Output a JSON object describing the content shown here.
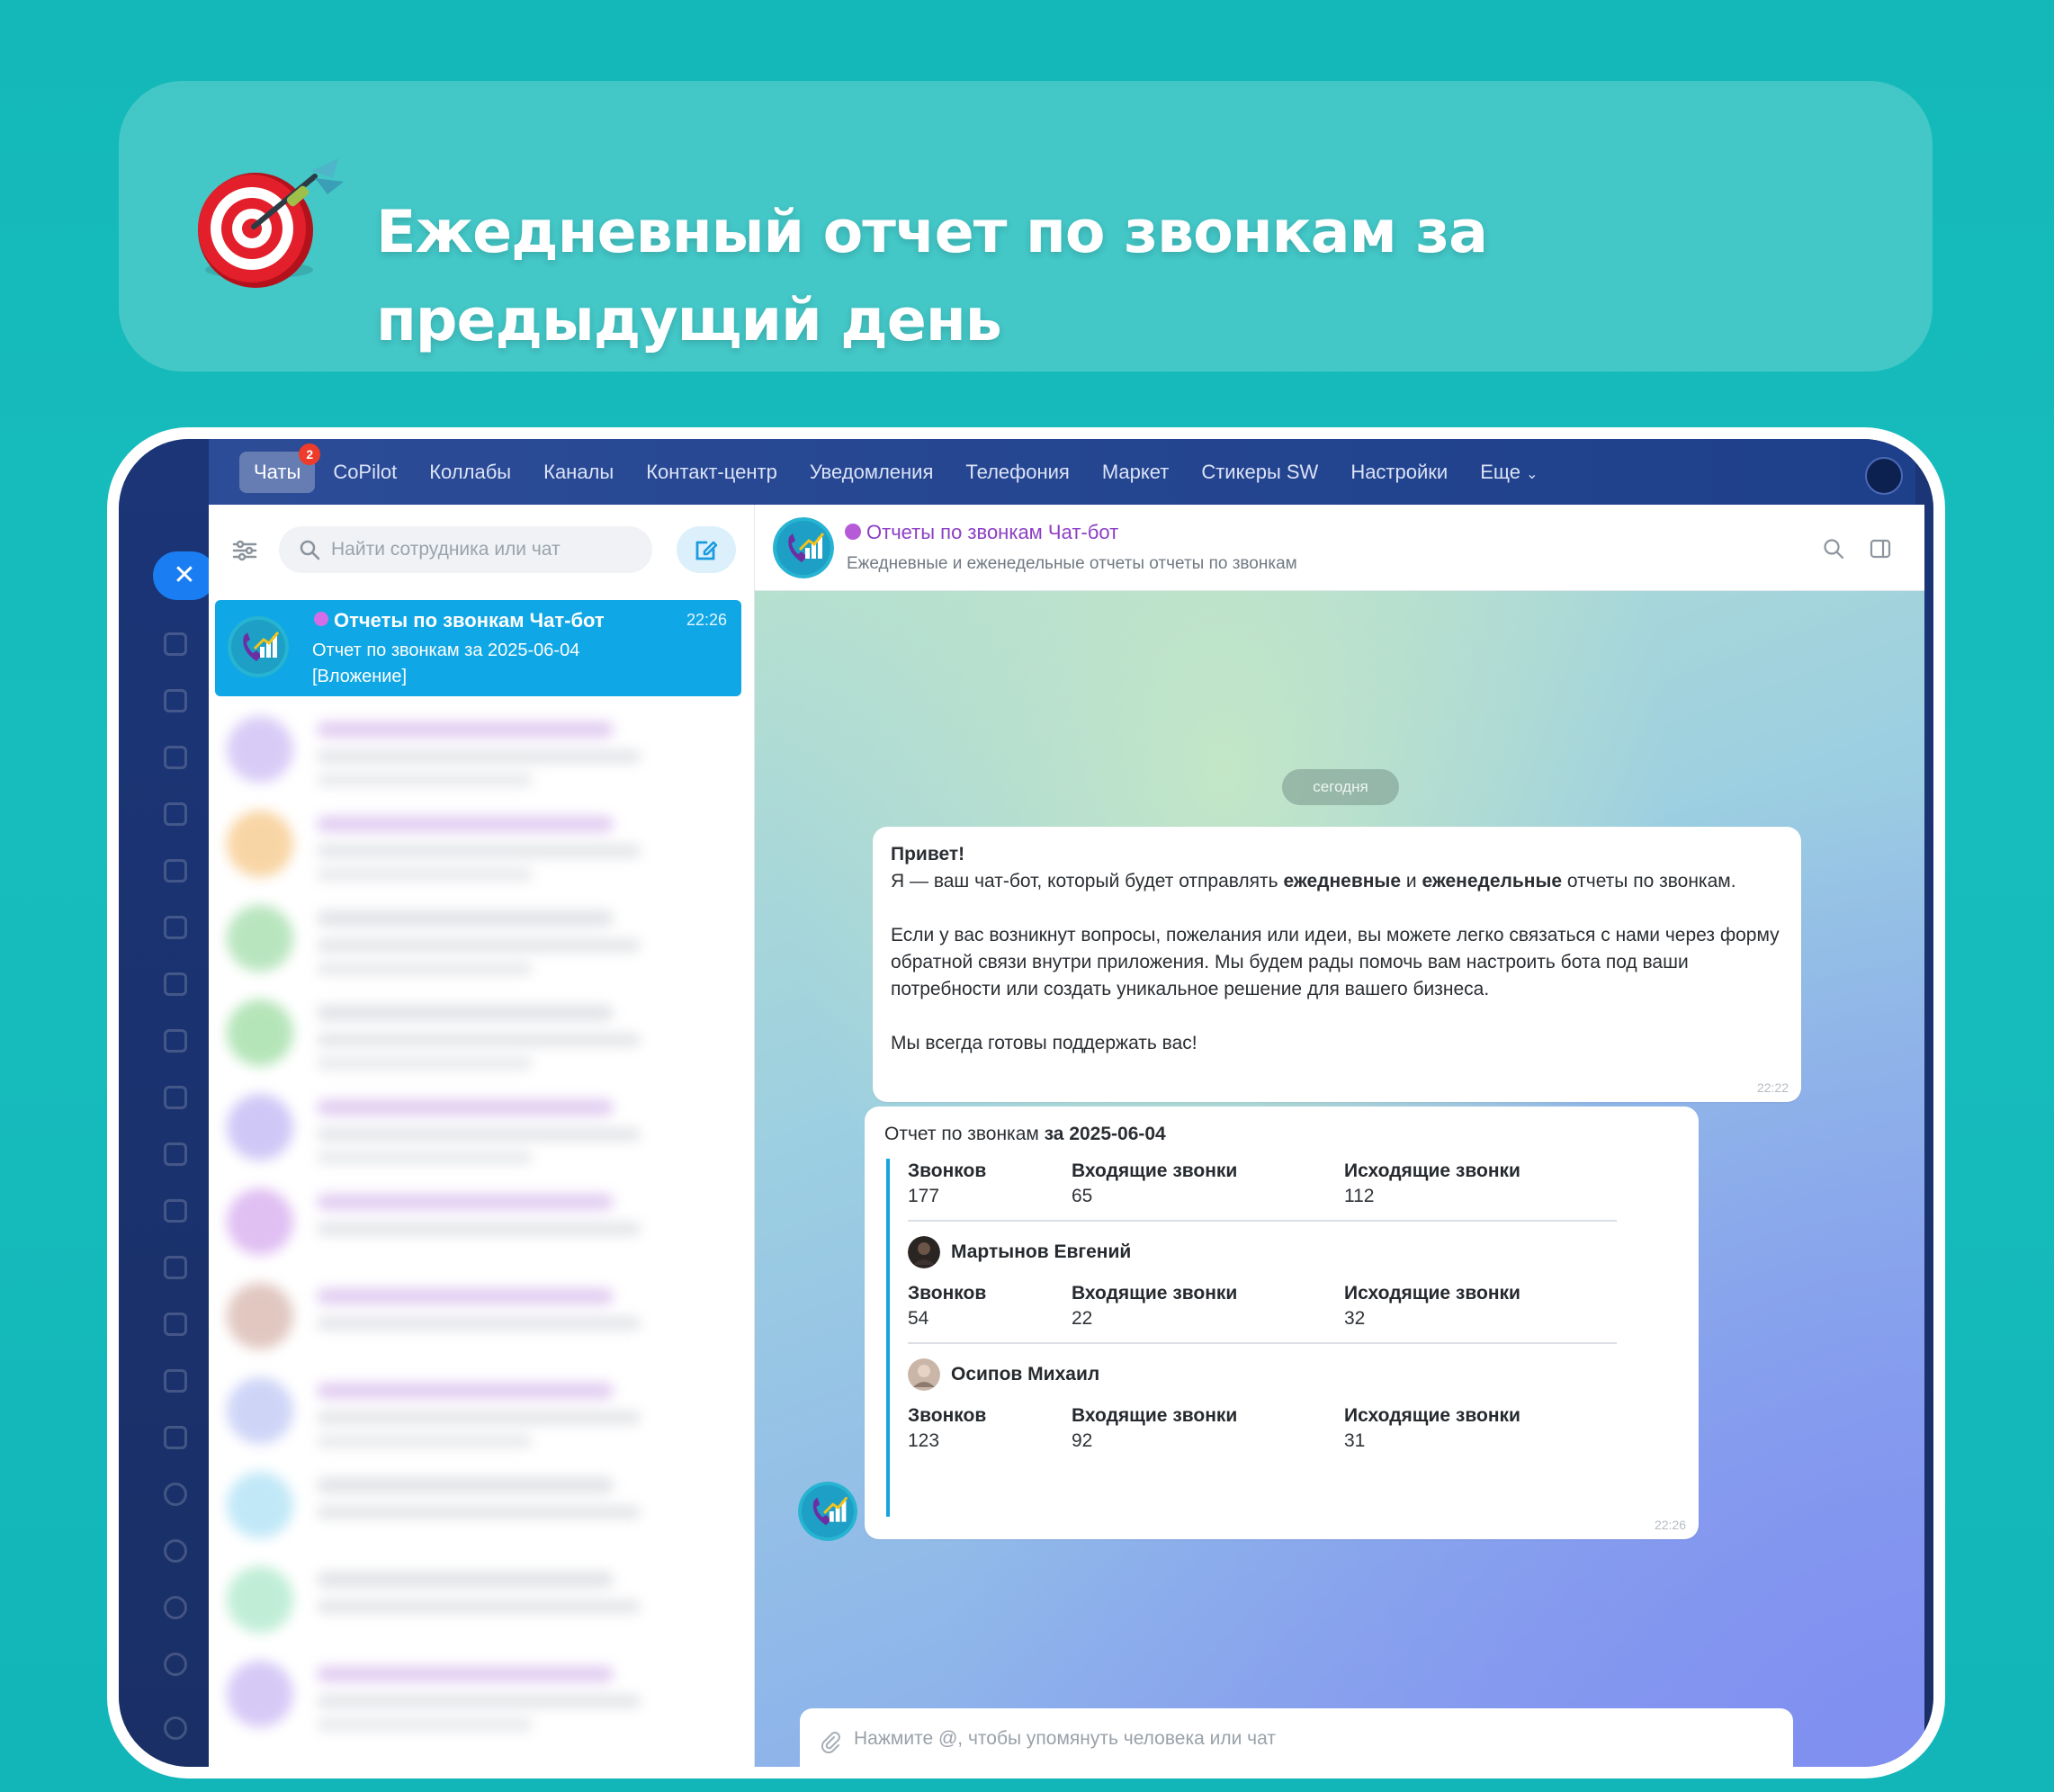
{
  "banner": {
    "title": "Ежедневный отчет по звонкам за предыдущий день",
    "icon": "dart-target-icon"
  },
  "nav": {
    "items": [
      "Чаты",
      "CoPilot",
      "Коллабы",
      "Каналы",
      "Контакт-центр",
      "Уведомления",
      "Телефония",
      "Маркет",
      "Стикеры SW",
      "Настройки",
      "Еще"
    ],
    "chats_badge": "2",
    "more_suffix": "⌄"
  },
  "sidebar": {
    "search_placeholder": "Найти сотрудника или чат"
  },
  "active_chat": {
    "name": "Отчеты по звонкам Чат-бот",
    "time": "22:26",
    "preview_line1": "Отчет по звонкам за 2025-06-04",
    "preview_line2": "[Вложение]"
  },
  "header": {
    "title": "Отчеты по звонкам Чат-бот",
    "subtitle": "Ежедневные и еженедельные отчеты отчеты по звонкам"
  },
  "messages": {
    "date_divider": "сегодня",
    "welcome": {
      "greeting": "Привет!",
      "line1_a": "Я — ваш чат-бот, который будет отправлять ",
      "line1_b": "ежедневные",
      "line1_c": " и ",
      "line1_d": "еженедельные",
      "line1_e": " отчеты по звонкам.",
      "para2": "Если у вас возникнут вопросы, пожелания или идеи, вы можете легко связаться с нами через форму обратной связи внутри приложения. Мы будем рады помочь вам настроить бота под ваши потребности или создать уникальное решение для вашего бизнеса.",
      "para3": "Мы всегда готовы поддержать вас!",
      "time": "22:22"
    },
    "report": {
      "title_a": "Отчет по звонкам ",
      "title_b": "за 2025-06-04",
      "labels": {
        "calls": "Звонков",
        "incoming": "Входящие звонки",
        "outgoing": "Исходящие звонки"
      },
      "total": {
        "calls": "177",
        "incoming": "65",
        "outgoing": "112"
      },
      "people": [
        {
          "name": "Мартынов Евгений",
          "calls": "54",
          "incoming": "22",
          "outgoing": "32"
        },
        {
          "name": "Осипов Михаил",
          "calls": "123",
          "incoming": "92",
          "outgoing": "31"
        }
      ],
      "time": "22:26"
    }
  },
  "composer": {
    "placeholder": "Нажмите @, чтобы упомянуть человека или чат"
  },
  "colors": {
    "accent": "#10a7e6",
    "bot_name": "#8c3fc4",
    "page_bg": "#14b8b8"
  }
}
